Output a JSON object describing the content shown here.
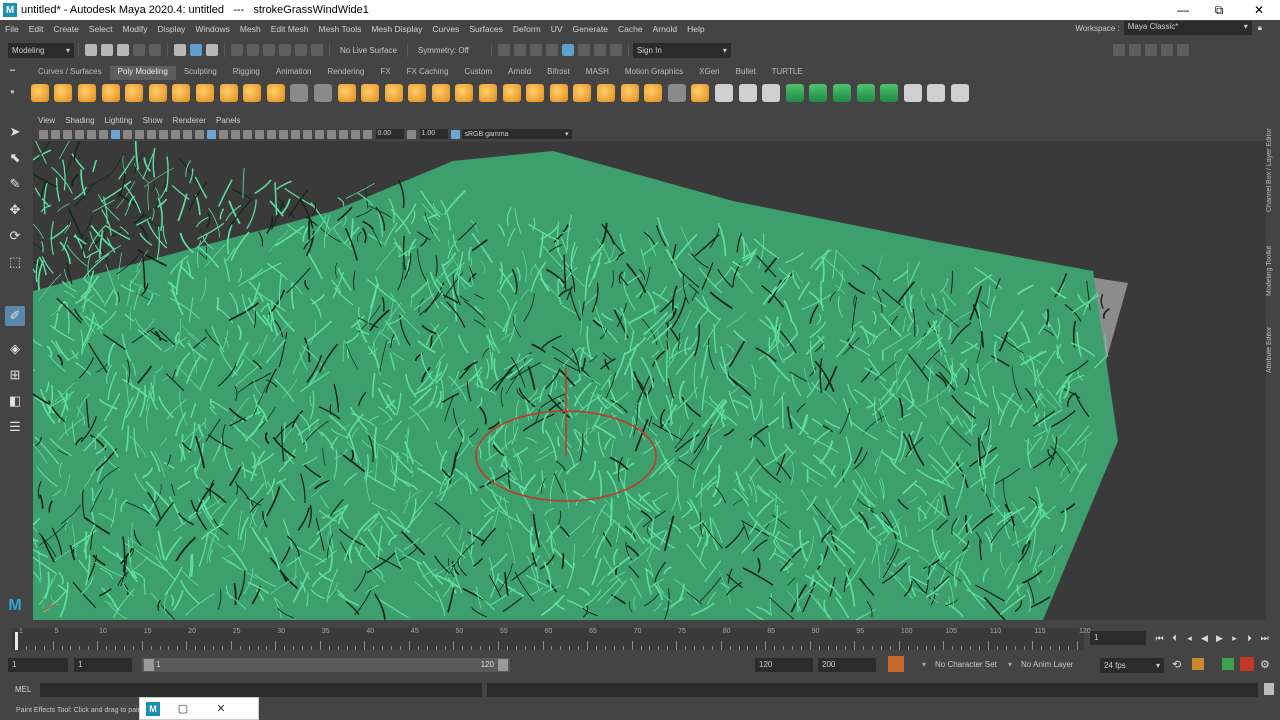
{
  "window": {
    "title": "untitled* - Autodesk Maya 2020.4: untitled   ---   strokeGrassWindWide1",
    "app_icon": "M",
    "minimize": "—",
    "maximize": "⧉",
    "close": "✕"
  },
  "menus": [
    "File",
    "Edit",
    "Create",
    "Select",
    "Modify",
    "Display",
    "Windows",
    "Mesh",
    "Edit Mesh",
    "Mesh Tools",
    "Mesh Display",
    "Curves",
    "Surfaces",
    "Deform",
    "UV",
    "Generate",
    "Cache",
    "Arnold",
    "Help"
  ],
  "workspace": {
    "label": "Workspace :",
    "value": "Maya Classic*"
  },
  "status_line": {
    "menu_set": "Modeling",
    "live_surface": "No Live Surface",
    "symmetry": "Symmetry: Off",
    "sign_in": "Sign In"
  },
  "shelf": {
    "tabs": [
      "Curves / Surfaces",
      "Poly Modeling",
      "Sculpting",
      "Rigging",
      "Animation",
      "Rendering",
      "FX",
      "FX Caching",
      "Custom",
      "Arnold",
      "Bifrost",
      "MASH",
      "Motion Graphics",
      "XGen",
      "Bullet",
      "TURTLE"
    ],
    "active_tab": "Poly Modeling"
  },
  "panel": {
    "menus": [
      "View",
      "Shading",
      "Lighting",
      "Show",
      "Renderer",
      "Panels"
    ],
    "exposure": "0.00",
    "gamma": "1.00",
    "color_space": "sRGB gamma"
  },
  "side_tabs": [
    "Channel Box / Layer Editor",
    "Modeling Toolkit",
    "Attribute Editor"
  ],
  "timeline": {
    "ticks": [
      "1",
      "5",
      "10",
      "15",
      "20",
      "25",
      "30",
      "35",
      "40",
      "45",
      "50",
      "55",
      "60",
      "65",
      "70",
      "75",
      "80",
      "85",
      "90",
      "95",
      "100",
      "105",
      "110",
      "115",
      "120"
    ],
    "current_frame": "1"
  },
  "range": {
    "start": "1",
    "playback_start": "1",
    "range_start": "1",
    "range_end": "120",
    "playback_end": "120",
    "end": "200",
    "character_set": "No Character Set",
    "anim_layer": "No Anim Layer",
    "fps": "24 fps"
  },
  "command_line": {
    "label": "MEL"
  },
  "help_line": "Paint Effects Tool: Click and drag to paint.",
  "colors": {
    "grass": "#5fe0a0",
    "ui_background": "#444444",
    "viewport_background": "#393939",
    "manipulator": "#c0392b"
  }
}
